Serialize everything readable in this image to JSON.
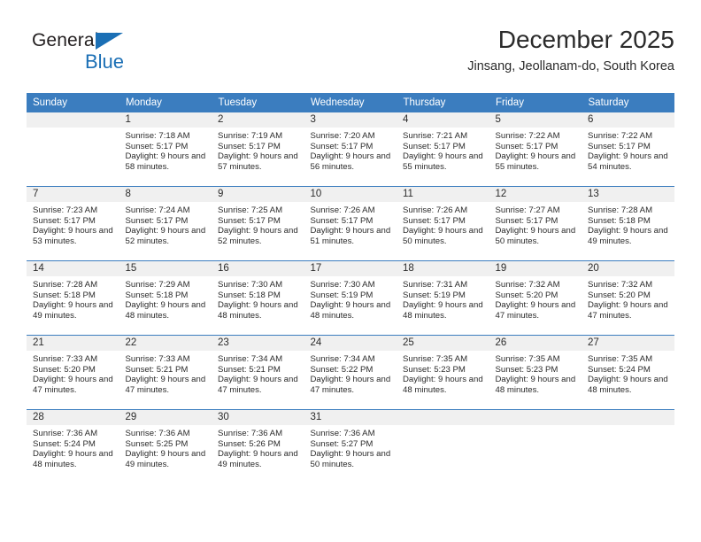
{
  "logo": {
    "word_top": "General",
    "word_bottom": "Blue",
    "triangle_color": "#1b6fb5"
  },
  "header": {
    "month_title": "December 2025",
    "location": "Jinsang, Jeollanam-do, South Korea"
  },
  "theme": {
    "header_blue": "#3b7dbf",
    "daynum_strip": "#f0f0f0",
    "text": "#2b2b2b"
  },
  "weekday_headers": [
    "Sunday",
    "Monday",
    "Tuesday",
    "Wednesday",
    "Thursday",
    "Friday",
    "Saturday"
  ],
  "weeks": [
    {
      "days": [
        {
          "num": "",
          "sunrise": "",
          "sunset": "",
          "daylight": "",
          "empty": true
        },
        {
          "num": "1",
          "sunrise": "Sunrise: 7:18 AM",
          "sunset": "Sunset: 5:17 PM",
          "daylight": "Daylight: 9 hours and 58 minutes."
        },
        {
          "num": "2",
          "sunrise": "Sunrise: 7:19 AM",
          "sunset": "Sunset: 5:17 PM",
          "daylight": "Daylight: 9 hours and 57 minutes."
        },
        {
          "num": "3",
          "sunrise": "Sunrise: 7:20 AM",
          "sunset": "Sunset: 5:17 PM",
          "daylight": "Daylight: 9 hours and 56 minutes."
        },
        {
          "num": "4",
          "sunrise": "Sunrise: 7:21 AM",
          "sunset": "Sunset: 5:17 PM",
          "daylight": "Daylight: 9 hours and 55 minutes."
        },
        {
          "num": "5",
          "sunrise": "Sunrise: 7:22 AM",
          "sunset": "Sunset: 5:17 PM",
          "daylight": "Daylight: 9 hours and 55 minutes."
        },
        {
          "num": "6",
          "sunrise": "Sunrise: 7:22 AM",
          "sunset": "Sunset: 5:17 PM",
          "daylight": "Daylight: 9 hours and 54 minutes."
        }
      ]
    },
    {
      "days": [
        {
          "num": "7",
          "sunrise": "Sunrise: 7:23 AM",
          "sunset": "Sunset: 5:17 PM",
          "daylight": "Daylight: 9 hours and 53 minutes."
        },
        {
          "num": "8",
          "sunrise": "Sunrise: 7:24 AM",
          "sunset": "Sunset: 5:17 PM",
          "daylight": "Daylight: 9 hours and 52 minutes."
        },
        {
          "num": "9",
          "sunrise": "Sunrise: 7:25 AM",
          "sunset": "Sunset: 5:17 PM",
          "daylight": "Daylight: 9 hours and 52 minutes."
        },
        {
          "num": "10",
          "sunrise": "Sunrise: 7:26 AM",
          "sunset": "Sunset: 5:17 PM",
          "daylight": "Daylight: 9 hours and 51 minutes."
        },
        {
          "num": "11",
          "sunrise": "Sunrise: 7:26 AM",
          "sunset": "Sunset: 5:17 PM",
          "daylight": "Daylight: 9 hours and 50 minutes."
        },
        {
          "num": "12",
          "sunrise": "Sunrise: 7:27 AM",
          "sunset": "Sunset: 5:17 PM",
          "daylight": "Daylight: 9 hours and 50 minutes."
        },
        {
          "num": "13",
          "sunrise": "Sunrise: 7:28 AM",
          "sunset": "Sunset: 5:18 PM",
          "daylight": "Daylight: 9 hours and 49 minutes."
        }
      ]
    },
    {
      "days": [
        {
          "num": "14",
          "sunrise": "Sunrise: 7:28 AM",
          "sunset": "Sunset: 5:18 PM",
          "daylight": "Daylight: 9 hours and 49 minutes."
        },
        {
          "num": "15",
          "sunrise": "Sunrise: 7:29 AM",
          "sunset": "Sunset: 5:18 PM",
          "daylight": "Daylight: 9 hours and 48 minutes."
        },
        {
          "num": "16",
          "sunrise": "Sunrise: 7:30 AM",
          "sunset": "Sunset: 5:18 PM",
          "daylight": "Daylight: 9 hours and 48 minutes."
        },
        {
          "num": "17",
          "sunrise": "Sunrise: 7:30 AM",
          "sunset": "Sunset: 5:19 PM",
          "daylight": "Daylight: 9 hours and 48 minutes."
        },
        {
          "num": "18",
          "sunrise": "Sunrise: 7:31 AM",
          "sunset": "Sunset: 5:19 PM",
          "daylight": "Daylight: 9 hours and 48 minutes."
        },
        {
          "num": "19",
          "sunrise": "Sunrise: 7:32 AM",
          "sunset": "Sunset: 5:20 PM",
          "daylight": "Daylight: 9 hours and 47 minutes."
        },
        {
          "num": "20",
          "sunrise": "Sunrise: 7:32 AM",
          "sunset": "Sunset: 5:20 PM",
          "daylight": "Daylight: 9 hours and 47 minutes."
        }
      ]
    },
    {
      "days": [
        {
          "num": "21",
          "sunrise": "Sunrise: 7:33 AM",
          "sunset": "Sunset: 5:20 PM",
          "daylight": "Daylight: 9 hours and 47 minutes."
        },
        {
          "num": "22",
          "sunrise": "Sunrise: 7:33 AM",
          "sunset": "Sunset: 5:21 PM",
          "daylight": "Daylight: 9 hours and 47 minutes."
        },
        {
          "num": "23",
          "sunrise": "Sunrise: 7:34 AM",
          "sunset": "Sunset: 5:21 PM",
          "daylight": "Daylight: 9 hours and 47 minutes."
        },
        {
          "num": "24",
          "sunrise": "Sunrise: 7:34 AM",
          "sunset": "Sunset: 5:22 PM",
          "daylight": "Daylight: 9 hours and 47 minutes."
        },
        {
          "num": "25",
          "sunrise": "Sunrise: 7:35 AM",
          "sunset": "Sunset: 5:23 PM",
          "daylight": "Daylight: 9 hours and 48 minutes."
        },
        {
          "num": "26",
          "sunrise": "Sunrise: 7:35 AM",
          "sunset": "Sunset: 5:23 PM",
          "daylight": "Daylight: 9 hours and 48 minutes."
        },
        {
          "num": "27",
          "sunrise": "Sunrise: 7:35 AM",
          "sunset": "Sunset: 5:24 PM",
          "daylight": "Daylight: 9 hours and 48 minutes."
        }
      ]
    },
    {
      "days": [
        {
          "num": "28",
          "sunrise": "Sunrise: 7:36 AM",
          "sunset": "Sunset: 5:24 PM",
          "daylight": "Daylight: 9 hours and 48 minutes."
        },
        {
          "num": "29",
          "sunrise": "Sunrise: 7:36 AM",
          "sunset": "Sunset: 5:25 PM",
          "daylight": "Daylight: 9 hours and 49 minutes."
        },
        {
          "num": "30",
          "sunrise": "Sunrise: 7:36 AM",
          "sunset": "Sunset: 5:26 PM",
          "daylight": "Daylight: 9 hours and 49 minutes."
        },
        {
          "num": "31",
          "sunrise": "Sunrise: 7:36 AM",
          "sunset": "Sunset: 5:27 PM",
          "daylight": "Daylight: 9 hours and 50 minutes."
        },
        {
          "num": "",
          "sunrise": "",
          "sunset": "",
          "daylight": "",
          "empty": true
        },
        {
          "num": "",
          "sunrise": "",
          "sunset": "",
          "daylight": "",
          "empty": true
        },
        {
          "num": "",
          "sunrise": "",
          "sunset": "",
          "daylight": "",
          "empty": true
        }
      ]
    }
  ]
}
